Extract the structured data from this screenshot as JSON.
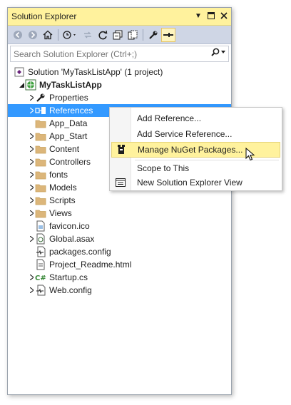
{
  "panel": {
    "title": "Solution Explorer"
  },
  "search": {
    "placeholder": "Search Solution Explorer (Ctrl+;)"
  },
  "tree": {
    "solution": "Solution 'MyTaskListApp' (1 project)",
    "project": "MyTaskListApp",
    "items": [
      {
        "label": "Properties",
        "icon": "wrench-icon",
        "expandable": true
      },
      {
        "label": "References",
        "icon": "references-icon",
        "expandable": true,
        "selected": true
      },
      {
        "label": "App_Data",
        "icon": "folder-icon",
        "expandable": false
      },
      {
        "label": "App_Start",
        "icon": "folder-icon",
        "expandable": true
      },
      {
        "label": "Content",
        "icon": "folder-icon",
        "expandable": true
      },
      {
        "label": "Controllers",
        "icon": "folder-icon",
        "expandable": true
      },
      {
        "label": "fonts",
        "icon": "folder-icon",
        "expandable": true
      },
      {
        "label": "Models",
        "icon": "folder-icon",
        "expandable": true
      },
      {
        "label": "Scripts",
        "icon": "folder-icon",
        "expandable": true
      },
      {
        "label": "Views",
        "icon": "folder-icon",
        "expandable": true
      },
      {
        "label": "favicon.ico",
        "icon": "image-file-icon",
        "expandable": false
      },
      {
        "label": "Global.asax",
        "icon": "asax-file-icon",
        "expandable": true
      },
      {
        "label": "packages.config",
        "icon": "config-file-icon",
        "expandable": false
      },
      {
        "label": "Project_Readme.html",
        "icon": "html-file-icon",
        "expandable": false
      },
      {
        "label": "Startup.cs",
        "icon": "csharp-file-icon",
        "expandable": true
      },
      {
        "label": "Web.config",
        "icon": "config-file-icon",
        "expandable": true
      }
    ]
  },
  "context_menu": {
    "items": [
      {
        "label": "Add Reference...",
        "icon": ""
      },
      {
        "label": "Add Service Reference...",
        "icon": ""
      },
      {
        "label": "Manage NuGet Packages...",
        "icon": "nuget-icon",
        "highlighted": true
      },
      {
        "label": "Scope to This",
        "icon": ""
      },
      {
        "label": "New Solution Explorer View",
        "icon": "new-view-icon"
      }
    ]
  },
  "colors": {
    "title_bg": "#fff29d",
    "toolbar_bg": "#cfd6e5",
    "selection": "#3399ff",
    "folder": "#dcb67a"
  }
}
